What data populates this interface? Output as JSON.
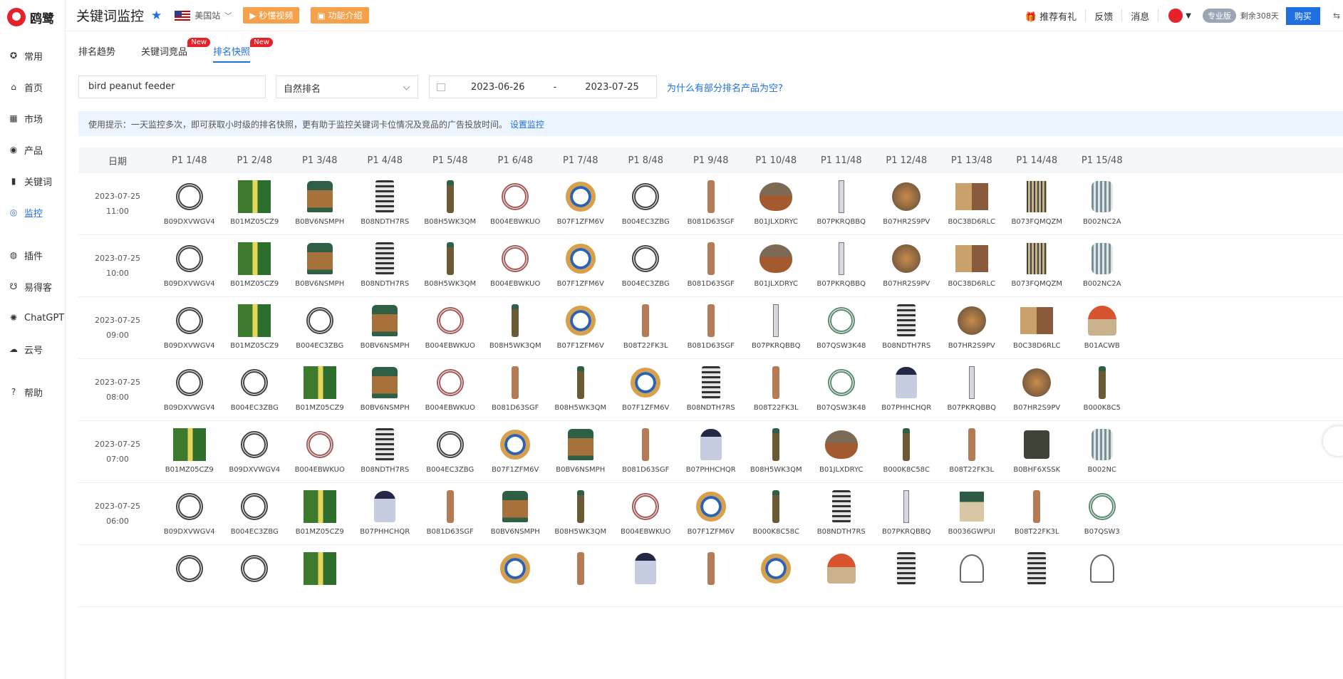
{
  "app": {
    "logo_text": "鸥鹭"
  },
  "sidebar": {
    "items": [
      {
        "label": "常用",
        "icon": "star-circle-icon"
      },
      {
        "label": "首页",
        "icon": "home-icon"
      },
      {
        "label": "市场",
        "icon": "grid-icon"
      },
      {
        "label": "产品",
        "icon": "eye-icon"
      },
      {
        "label": "关键词",
        "icon": "bar-chart-icon"
      },
      {
        "label": "监控",
        "icon": "monitor-icon",
        "active": true
      },
      {
        "label": "插件",
        "icon": "chrome-icon"
      },
      {
        "label": "易得客",
        "icon": "cart-icon"
      },
      {
        "label": "ChatGPT",
        "icon": "openai-icon"
      },
      {
        "label": "云号",
        "icon": "cloud-icon"
      },
      {
        "label": "帮助",
        "icon": "question-icon"
      }
    ]
  },
  "header": {
    "title": "关键词监控",
    "site": "美国站",
    "video_btn": "秒懂视频",
    "intro_btn": "功能介绍",
    "gift": "推荐有礼",
    "feedback": "反馈",
    "messages": "消息",
    "plan": "专业版",
    "remaining": "剩余308天",
    "buy": "购买"
  },
  "tabs": [
    {
      "label": "排名趋势"
    },
    {
      "label": "关键词竞品",
      "badge": "New"
    },
    {
      "label": "排名快照",
      "badge": "New",
      "active": true
    }
  ],
  "filters": {
    "keyword": "bird peanut feeder",
    "rank_type": "自然排名",
    "date_start": "2023-06-26",
    "date_sep": "-",
    "date_end": "2023-07-25",
    "why_link": "为什么有部分排名产品为空?"
  },
  "tip": {
    "text": "使用提示：一天监控多次，即可获取小时级的排名快照，更有助于监控关键词卡位情况及竞品的广告投放时间。",
    "link": "设置监控"
  },
  "table": {
    "date_header": "日期",
    "columns": [
      "P1 1/48",
      "P1 2/48",
      "P1 3/48",
      "P1 4/48",
      "P1 5/48",
      "P1 6/48",
      "P1 7/48",
      "P1 8/48",
      "P1 9/48",
      "P1 10/48",
      "P1 11/48",
      "P1 12/48",
      "P1 13/48",
      "P1 14/48",
      "P1 15/48"
    ],
    "rows": [
      {
        "date": "2023-07-25",
        "time": "11:00",
        "cells": [
          {
            "asin": "B09DXVWGV4",
            "t": "wreath"
          },
          {
            "asin": "B01MZ05CZ9",
            "t": "box"
          },
          {
            "asin": "B0BV6NSMPH",
            "t": "lantern"
          },
          {
            "asin": "B08NDTH7RS",
            "t": "cage"
          },
          {
            "asin": "B08H5WK3QM",
            "t": "tube"
          },
          {
            "asin": "B004EBWKUO",
            "t": "pinkwreath"
          },
          {
            "asin": "B07F1ZFM6V",
            "t": "wreathbird"
          },
          {
            "asin": "B004EC3ZBG",
            "t": "wreath"
          },
          {
            "asin": "B081D63SGF",
            "t": "copper"
          },
          {
            "asin": "B01JLXDRYC",
            "t": "acorn"
          },
          {
            "asin": "B07PKRQBBQ",
            "t": "thin"
          },
          {
            "asin": "B07HR2S9PV",
            "t": "sphere"
          },
          {
            "asin": "B0C38D6RLC",
            "t": "house"
          },
          {
            "asin": "B073FQMQZM",
            "t": "mesh"
          },
          {
            "asin": "B002NC2A",
            "t": "bluecage"
          }
        ]
      },
      {
        "date": "2023-07-25",
        "time": "10:00",
        "cells": [
          {
            "asin": "B09DXVWGV4",
            "t": "wreath"
          },
          {
            "asin": "B01MZ05CZ9",
            "t": "box"
          },
          {
            "asin": "B0BV6NSMPH",
            "t": "lantern"
          },
          {
            "asin": "B08NDTH7RS",
            "t": "cage"
          },
          {
            "asin": "B08H5WK3QM",
            "t": "tube"
          },
          {
            "asin": "B004EBWKUO",
            "t": "pinkwreath"
          },
          {
            "asin": "B07F1ZFM6V",
            "t": "wreathbird"
          },
          {
            "asin": "B004EC3ZBG",
            "t": "wreath"
          },
          {
            "asin": "B081D63SGF",
            "t": "copper"
          },
          {
            "asin": "B01JLXDRYC",
            "t": "acorn"
          },
          {
            "asin": "B07PKRQBBQ",
            "t": "thin"
          },
          {
            "asin": "B07HR2S9PV",
            "t": "sphere"
          },
          {
            "asin": "B0C38D6RLC",
            "t": "house"
          },
          {
            "asin": "B073FQMQZM",
            "t": "mesh"
          },
          {
            "asin": "B002NC2A",
            "t": "bluecage"
          }
        ]
      },
      {
        "date": "2023-07-25",
        "time": "09:00",
        "cells": [
          {
            "asin": "B09DXVWGV4",
            "t": "wreath"
          },
          {
            "asin": "B01MZ05CZ9",
            "t": "box"
          },
          {
            "asin": "B004EC3ZBG",
            "t": "wreath"
          },
          {
            "asin": "B0BV6NSMPH",
            "t": "lantern"
          },
          {
            "asin": "B004EBWKUO",
            "t": "pinkwreath"
          },
          {
            "asin": "B08H5WK3QM",
            "t": "tube"
          },
          {
            "asin": "B07F1ZFM6V",
            "t": "wreathbird"
          },
          {
            "asin": "B08T22FK3L",
            "t": "copper"
          },
          {
            "asin": "B081D63SGF",
            "t": "copper"
          },
          {
            "asin": "B07PKRQBBQ",
            "t": "thin"
          },
          {
            "asin": "B07QSW3K48",
            "t": "greenwreath"
          },
          {
            "asin": "B08NDTH7RS",
            "t": "cage"
          },
          {
            "asin": "B07HR2S9PV",
            "t": "sphere"
          },
          {
            "asin": "B0C38D6RLC",
            "t": "house"
          },
          {
            "asin": "B01ACWB",
            "t": "mushroom"
          }
        ]
      },
      {
        "date": "2023-07-25",
        "time": "08:00",
        "cells": [
          {
            "asin": "B09DXVWGV4",
            "t": "wreath"
          },
          {
            "asin": "B004EC3ZBG",
            "t": "wreath"
          },
          {
            "asin": "B01MZ05CZ9",
            "t": "box"
          },
          {
            "asin": "B0BV6NSMPH",
            "t": "lantern"
          },
          {
            "asin": "B004EBWKUO",
            "t": "pinkwreath"
          },
          {
            "asin": "B081D63SGF",
            "t": "copper"
          },
          {
            "asin": "B08H5WK3QM",
            "t": "tube"
          },
          {
            "asin": "B07F1ZFM6V",
            "t": "wreathbird"
          },
          {
            "asin": "B08NDTH7RS",
            "t": "cage"
          },
          {
            "asin": "B08T22FK3L",
            "t": "copper"
          },
          {
            "asin": "B07QSW3K48",
            "t": "greenwreath"
          },
          {
            "asin": "B07PHHCHQR",
            "t": "lamp"
          },
          {
            "asin": "B07PKRQBBQ",
            "t": "thin"
          },
          {
            "asin": "B07HR2S9PV",
            "t": "sphere"
          },
          {
            "asin": "B000K8C5",
            "t": "tube"
          }
        ]
      },
      {
        "date": "2023-07-25",
        "time": "07:00",
        "cells": [
          {
            "asin": "B01MZ05CZ9",
            "t": "box"
          },
          {
            "asin": "B09DXVWGV4",
            "t": "wreath"
          },
          {
            "asin": "B004EBWKUO",
            "t": "pinkwreath"
          },
          {
            "asin": "B08NDTH7RS",
            "t": "cage"
          },
          {
            "asin": "B004EC3ZBG",
            "t": "wreath"
          },
          {
            "asin": "B07F1ZFM6V",
            "t": "wreathbird"
          },
          {
            "asin": "B0BV6NSMPH",
            "t": "lantern"
          },
          {
            "asin": "B081D63SGF",
            "t": "copper"
          },
          {
            "asin": "B07PHHCHQR",
            "t": "lamp"
          },
          {
            "asin": "B08H5WK3QM",
            "t": "tube"
          },
          {
            "asin": "B01JLXDRYC",
            "t": "acorn"
          },
          {
            "asin": "B000K8C58C",
            "t": "tube"
          },
          {
            "asin": "B08T22FK3L",
            "t": "copper"
          },
          {
            "asin": "B0BHF6XSSK",
            "t": "squirrel"
          },
          {
            "asin": "B002NC",
            "t": "bluecage"
          }
        ]
      },
      {
        "date": "2023-07-25",
        "time": "06:00",
        "cells": [
          {
            "asin": "B09DXVWGV4",
            "t": "wreath"
          },
          {
            "asin": "B004EC3ZBG",
            "t": "wreath"
          },
          {
            "asin": "B01MZ05CZ9",
            "t": "box"
          },
          {
            "asin": "B07PHHCHQR",
            "t": "lamp"
          },
          {
            "asin": "B081D63SGF",
            "t": "copper"
          },
          {
            "asin": "B0BV6NSMPH",
            "t": "lantern"
          },
          {
            "asin": "B08H5WK3QM",
            "t": "tube"
          },
          {
            "asin": "B004EBWKUO",
            "t": "pinkwreath"
          },
          {
            "asin": "B07F1ZFM6V",
            "t": "wreathbird"
          },
          {
            "asin": "B000K8C58C",
            "t": "tube"
          },
          {
            "asin": "B08NDTH7RS",
            "t": "cage"
          },
          {
            "asin": "B07PKRQBBQ",
            "t": "thin"
          },
          {
            "asin": "B0036GWPUI",
            "t": "roof"
          },
          {
            "asin": "B08T22FK3L",
            "t": "copper"
          },
          {
            "asin": "B07QSW3",
            "t": "greenwreath"
          }
        ]
      },
      {
        "date": "",
        "time": "",
        "cells": [
          {
            "asin": "",
            "t": "wreath"
          },
          {
            "asin": "",
            "t": "wreath"
          },
          {
            "asin": "",
            "t": "box"
          },
          {
            "asin": "",
            "t": "none"
          },
          {
            "asin": "",
            "t": "none"
          },
          {
            "asin": "",
            "t": "wreathbird"
          },
          {
            "asin": "",
            "t": "copper"
          },
          {
            "asin": "",
            "t": "lamp"
          },
          {
            "asin": "",
            "t": "copper"
          },
          {
            "asin": "",
            "t": "wreathbird"
          },
          {
            "asin": "",
            "t": "mushroom"
          },
          {
            "asin": "",
            "t": "cage"
          },
          {
            "asin": "",
            "t": "hook"
          },
          {
            "asin": "",
            "t": "cage"
          },
          {
            "asin": "",
            "t": "hook"
          }
        ]
      }
    ]
  },
  "colors": {
    "accent": "#1f6fe0",
    "brand": "#e5212a",
    "orange": "#f5a04a",
    "tip_bg": "#ecf5ff"
  }
}
